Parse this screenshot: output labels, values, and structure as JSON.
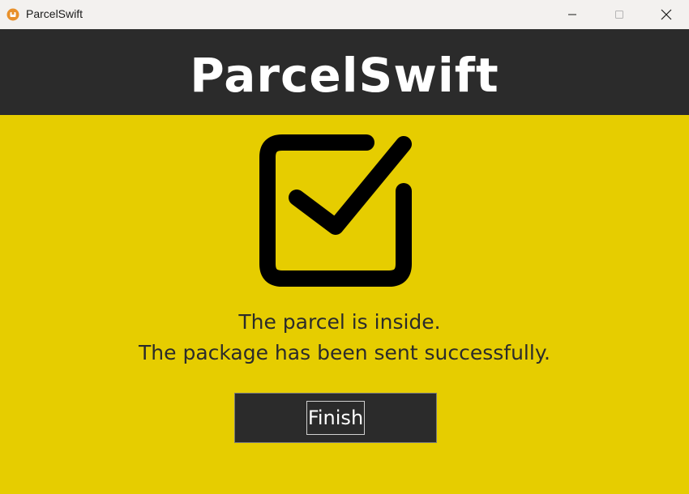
{
  "window": {
    "title": "ParcelSwift",
    "controls": {
      "minimize_icon": "minimize-icon",
      "maximize_icon": "maximize-icon",
      "close_icon": "close-icon"
    }
  },
  "header": {
    "title": "ParcelSwift"
  },
  "content": {
    "status_icon": "checkbox-checked-icon",
    "message_line1": "The parcel is inside.",
    "message_line2": "The package has been sent successfully.",
    "finish_label": "Finish"
  },
  "colors": {
    "background": "#e6cd00",
    "header": "#2b2b2b",
    "header_text": "#ffffff",
    "body_text": "#2b2b2b",
    "button": "#2b2b2b",
    "app_icon": "#f0a030"
  }
}
